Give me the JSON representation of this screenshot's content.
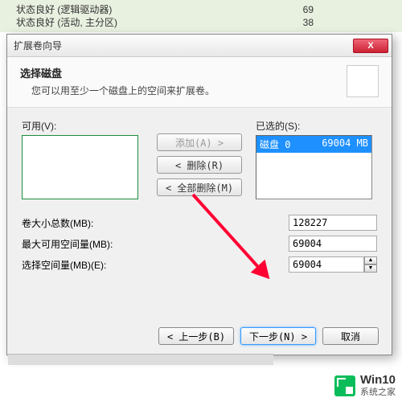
{
  "background": {
    "row1": {
      "label": "状态良好 (逻辑驱动器)",
      "value": "69"
    },
    "row2": {
      "label": "状态良好 (活动, 主分区)",
      "value": "38"
    }
  },
  "dialog": {
    "title": "扩展卷向导",
    "header": {
      "title": "选择磁盘",
      "subtitle": "您可以用至少一个磁盘上的空间来扩展卷。"
    },
    "available": {
      "label": "可用(V):"
    },
    "selected": {
      "label": "已选的(S):",
      "item_name": "磁盘 0",
      "item_size": "69004 MB"
    },
    "buttons": {
      "add": "添加(A) >",
      "remove": "< 删除(R)",
      "remove_all": "< 全部删除(M)"
    },
    "fields": {
      "total_label": "卷大小总数(MB):",
      "total_value": "128227",
      "max_label": "最大可用空间量(MB):",
      "max_value": "69004",
      "select_label": "选择空间量(MB)(E):",
      "select_value": "69004"
    },
    "footer": {
      "back": "< 上一步(B)",
      "next": "下一步(N) >",
      "cancel": "取消"
    },
    "close": "X"
  },
  "watermark": {
    "main": "Win10",
    "sub": "系统之家"
  }
}
